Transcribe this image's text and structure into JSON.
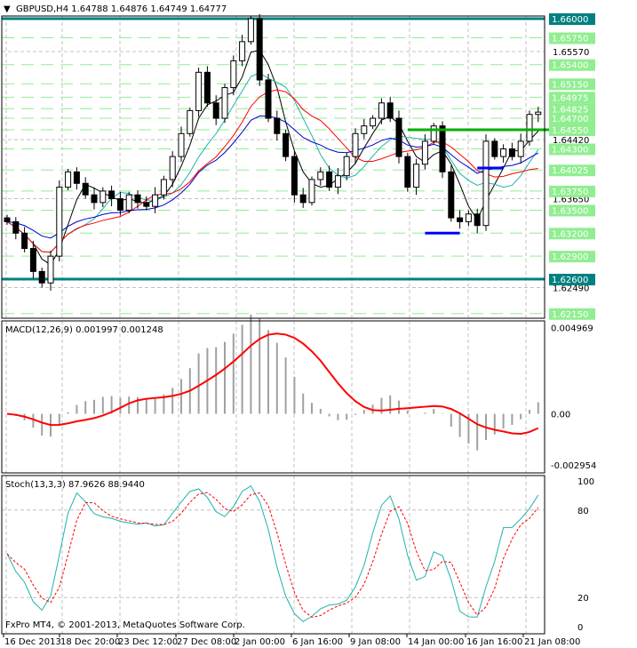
{
  "header": {
    "symbol": "GBPUSD,H4",
    "open": "1.64788",
    "high": "1.64876",
    "low": "1.64749",
    "close": "1.64777"
  },
  "macd_label": "MACD(12,26,9) 0.001997 0.001248",
  "stoch_label": "Stoch(13,3,3) 87.9626 88.9440",
  "copyright": "FxPro MT4, © 2001-2013, MetaQuotes Software Corp.",
  "colors": {
    "bull": "#000000",
    "grid": "#c0c0c0",
    "level": "#90ee90",
    "teal": "#008080",
    "macd_signal": "#ff0000",
    "stoch_main": "#20b2aa",
    "stoch_signal": "#ff0000"
  },
  "chart_data": {
    "type": "candlestick",
    "title": "GBPUSD,H4",
    "price_range": [
      1.62,
      1.6605
    ],
    "price_ticks": [
      "1.65570",
      "1.64420",
      "1.63650",
      "1.62490"
    ],
    "levels": [
      {
        "label": "1.66000",
        "value": 1.66,
        "style": "teal"
      },
      {
        "label": "1.65750",
        "value": 1.6575
      },
      {
        "label": "1.65400",
        "value": 1.654
      },
      {
        "label": "1.65150",
        "value": 1.6515
      },
      {
        "label": "1.64975",
        "value": 1.64975
      },
      {
        "label": "1.64825",
        "value": 1.64825
      },
      {
        "label": "1.64700",
        "value": 1.647
      },
      {
        "label": "1.64550",
        "value": 1.6455
      },
      {
        "label": "1.64300",
        "value": 1.643
      },
      {
        "label": "1.64025",
        "value": 1.64025
      },
      {
        "label": "1.63750",
        "value": 1.6375
      },
      {
        "label": "1.63500",
        "value": 1.635
      },
      {
        "label": "1.63200",
        "value": 1.632
      },
      {
        "label": "1.62900",
        "value": 1.629
      },
      {
        "label": "1.62600",
        "value": 1.626,
        "style": "teal"
      },
      {
        "label": "1.62150",
        "value": 1.6215
      }
    ],
    "x_labels": [
      "16 Dec 2013",
      "18 Dec 20:00",
      "23 Dec 12:00",
      "27 Dec 08:00",
      "2 Jan 00:00",
      "6 Jan 16:00",
      "9 Jan 08:00",
      "14 Jan 00:00",
      "16 Jan 16:00",
      "21 Jan 08:00"
    ],
    "closes": [
      1.6335,
      1.632,
      1.63,
      1.627,
      1.6255,
      1.629,
      1.638,
      1.64,
      1.6385,
      1.637,
      1.636,
      1.6375,
      1.6365,
      1.635,
      1.637,
      1.636,
      1.6355,
      1.637,
      1.639,
      1.642,
      1.645,
      1.648,
      1.653,
      1.649,
      1.647,
      1.651,
      1.6545,
      1.657,
      1.66,
      1.652,
      1.647,
      1.645,
      1.642,
      1.637,
      1.636,
      1.639,
      1.64,
      1.638,
      1.6395,
      1.642,
      1.645,
      1.646,
      1.647,
      1.649,
      1.647,
      1.642,
      1.638,
      1.641,
      1.644,
      1.646,
      1.64,
      1.634,
      1.6335,
      1.6345,
      1.633,
      1.644,
      1.642,
      1.643,
      1.642,
      1.644,
      1.6475,
      1.6478
    ],
    "annotations": [
      {
        "type": "hline",
        "value": 1.6455,
        "color": "#00b000",
        "from_bar": 46
      },
      {
        "type": "hline",
        "value": 1.632,
        "color": "#0000ff",
        "from_bar": 48,
        "to_bar": 52
      },
      {
        "type": "hline",
        "value": 1.6405,
        "color": "#0000ff",
        "from_bar": 54,
        "to_bar": 57
      }
    ],
    "macd": {
      "ticks": [
        "0.004969",
        "0.00",
        "-0.002954"
      ],
      "range": [
        -0.0032,
        0.0052
      ]
    },
    "stoch": {
      "ticks": [
        "100",
        "80",
        "20",
        "0"
      ],
      "range": [
        0,
        100
      ]
    }
  }
}
